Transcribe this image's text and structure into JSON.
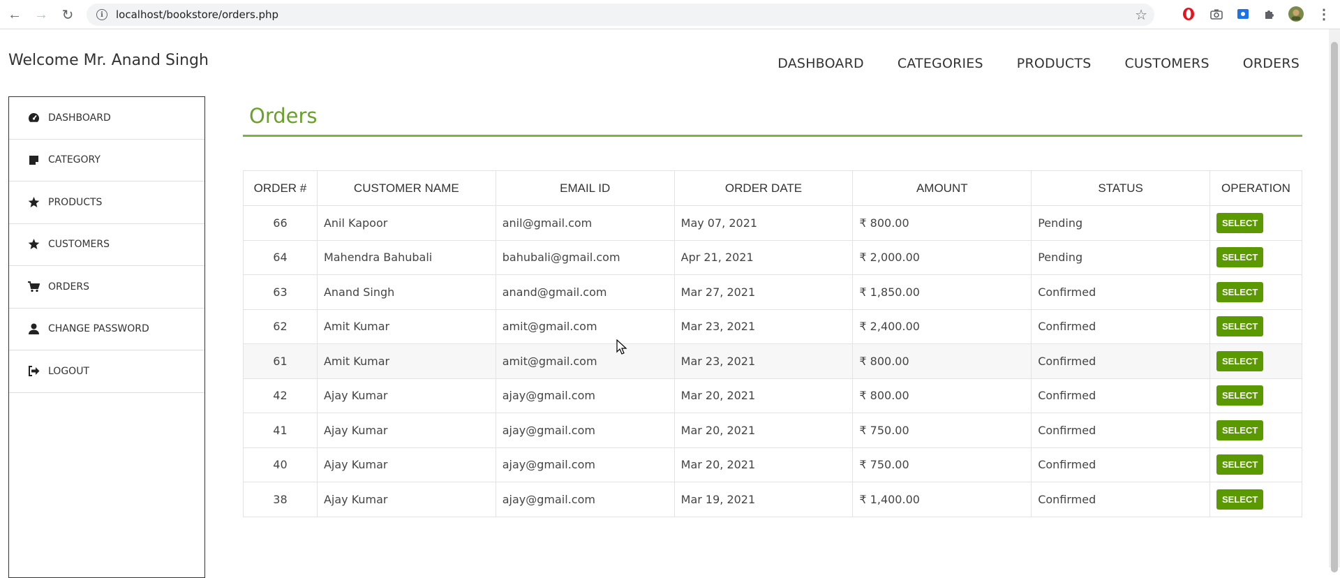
{
  "browser": {
    "url": "localhost/bookstore/orders.php"
  },
  "header": {
    "welcome": "Welcome Mr. Anand Singh",
    "nav": [
      "DASHBOARD",
      "CATEGORIES",
      "PRODUCTS",
      "CUSTOMERS",
      "ORDERS"
    ]
  },
  "sidebar": {
    "items": [
      {
        "label": "DASHBOARD",
        "icon": "dashboard-icon"
      },
      {
        "label": "CATEGORY",
        "icon": "category-icon"
      },
      {
        "label": "PRODUCTS",
        "icon": "star-icon"
      },
      {
        "label": "CUSTOMERS",
        "icon": "star-icon"
      },
      {
        "label": "ORDERS",
        "icon": "cart-icon"
      },
      {
        "label": "CHANGE PASSWORD",
        "icon": "user-icon"
      },
      {
        "label": "LOGOUT",
        "icon": "logout-icon"
      }
    ]
  },
  "main": {
    "title": "Orders",
    "columns": [
      "ORDER #",
      "CUSTOMER NAME",
      "EMAIL ID",
      "ORDER DATE",
      "AMOUNT",
      "STATUS",
      "OPERATION"
    ],
    "rows": [
      [
        "66",
        "Anil Kapoor",
        "anil@gmail.com",
        "May 07, 2021",
        "₹ 800.00",
        "Pending"
      ],
      [
        "64",
        "Mahendra Bahubali",
        "bahubali@gmail.com",
        "Apr 21, 2021",
        "₹ 2,000.00",
        "Pending"
      ],
      [
        "63",
        "Anand Singh",
        "anand@gmail.com",
        "Mar 27, 2021",
        "₹ 1,850.00",
        "Confirmed"
      ],
      [
        "62",
        "Amit Kumar",
        "amit@gmail.com",
        "Mar 23, 2021",
        "₹ 2,400.00",
        "Confirmed"
      ],
      [
        "61",
        "Amit Kumar",
        "amit@gmail.com",
        "Mar 23, 2021",
        "₹ 800.00",
        "Confirmed"
      ],
      [
        "42",
        "Ajay Kumar",
        "ajay@gmail.com",
        "Mar 20, 2021",
        "₹ 800.00",
        "Confirmed"
      ],
      [
        "41",
        "Ajay Kumar",
        "ajay@gmail.com",
        "Mar 20, 2021",
        "₹ 750.00",
        "Confirmed"
      ],
      [
        "40",
        "Ajay Kumar",
        "ajay@gmail.com",
        "Mar 20, 2021",
        "₹ 750.00",
        "Confirmed"
      ],
      [
        "38",
        "Ajay Kumar",
        "ajay@gmail.com",
        "Mar 19, 2021",
        "₹ 1,400.00",
        "Confirmed"
      ]
    ],
    "select_label": "SELECT",
    "highlighted_row": 4
  },
  "colors": {
    "accent": "#6aa12a",
    "button": "#5a9a00"
  }
}
